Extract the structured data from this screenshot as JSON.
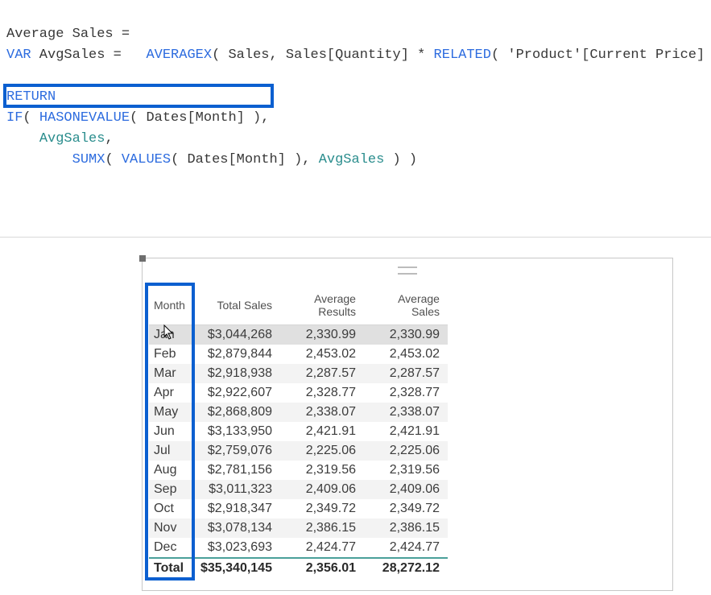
{
  "formula": {
    "line1": {
      "measure": "Average Sales",
      "eq": " ="
    },
    "line2": {
      "kw": "VAR",
      "name": " AvgSales",
      "eq2": " = ",
      "indent": "  ",
      "fn": "AVERAGEX",
      "open": "( ",
      "arg1": "Sales",
      "sep1": ", ",
      "arg2": "Sales[Quantity]",
      "op": " * ",
      "fn2": "RELATED",
      "open2": "( ",
      "arg3": "'Product'[Current Price]",
      "close2": " ) )"
    },
    "line3": "",
    "line4": {
      "kw": "RETURN"
    },
    "line5": {
      "fn": "IF",
      "open": "( ",
      "fn2": "HASONEVALUE",
      "open2": "( ",
      "arg": "Dates[Month]",
      "close2": " )",
      "sep": ","
    },
    "line6": {
      "indent": "    ",
      "var": "AvgSales",
      "sep": ","
    },
    "line7": {
      "indent": "        ",
      "fn": "SUMX",
      "open": "( ",
      "fn2": "VALUES",
      "open2": "( ",
      "arg": "Dates[Month]",
      "close2": " )",
      "sep": ", ",
      "var": "AvgSales",
      "close": " ) )"
    }
  },
  "table": {
    "headers": [
      "Month",
      "Total Sales",
      "Average Results",
      "Average Sales"
    ],
    "rows": [
      {
        "month": "Jan",
        "total": "$3,044,268",
        "avg_r": "2,330.99",
        "avg_s": "2,330.99"
      },
      {
        "month": "Feb",
        "total": "$2,879,844",
        "avg_r": "2,453.02",
        "avg_s": "2,453.02"
      },
      {
        "month": "Mar",
        "total": "$2,918,938",
        "avg_r": "2,287.57",
        "avg_s": "2,287.57"
      },
      {
        "month": "Apr",
        "total": "$2,922,607",
        "avg_r": "2,328.77",
        "avg_s": "2,328.77"
      },
      {
        "month": "May",
        "total": "$2,868,809",
        "avg_r": "2,338.07",
        "avg_s": "2,338.07"
      },
      {
        "month": "Jun",
        "total": "$3,133,950",
        "avg_r": "2,421.91",
        "avg_s": "2,421.91"
      },
      {
        "month": "Jul",
        "total": "$2,759,076",
        "avg_r": "2,225.06",
        "avg_s": "2,225.06"
      },
      {
        "month": "Aug",
        "total": "$2,781,156",
        "avg_r": "2,319.56",
        "avg_s": "2,319.56"
      },
      {
        "month": "Sep",
        "total": "$3,011,323",
        "avg_r": "2,409.06",
        "avg_s": "2,409.06"
      },
      {
        "month": "Oct",
        "total": "$2,918,347",
        "avg_r": "2,349.72",
        "avg_s": "2,349.72"
      },
      {
        "month": "Nov",
        "total": "$3,078,134",
        "avg_r": "2,386.15",
        "avg_s": "2,386.15"
      },
      {
        "month": "Dec",
        "total": "$3,023,693",
        "avg_r": "2,424.77",
        "avg_s": "2,424.77"
      }
    ],
    "total": {
      "label": "Total",
      "total": "$35,340,145",
      "avg_r": "2,356.01",
      "avg_s": "28,272.12"
    }
  }
}
